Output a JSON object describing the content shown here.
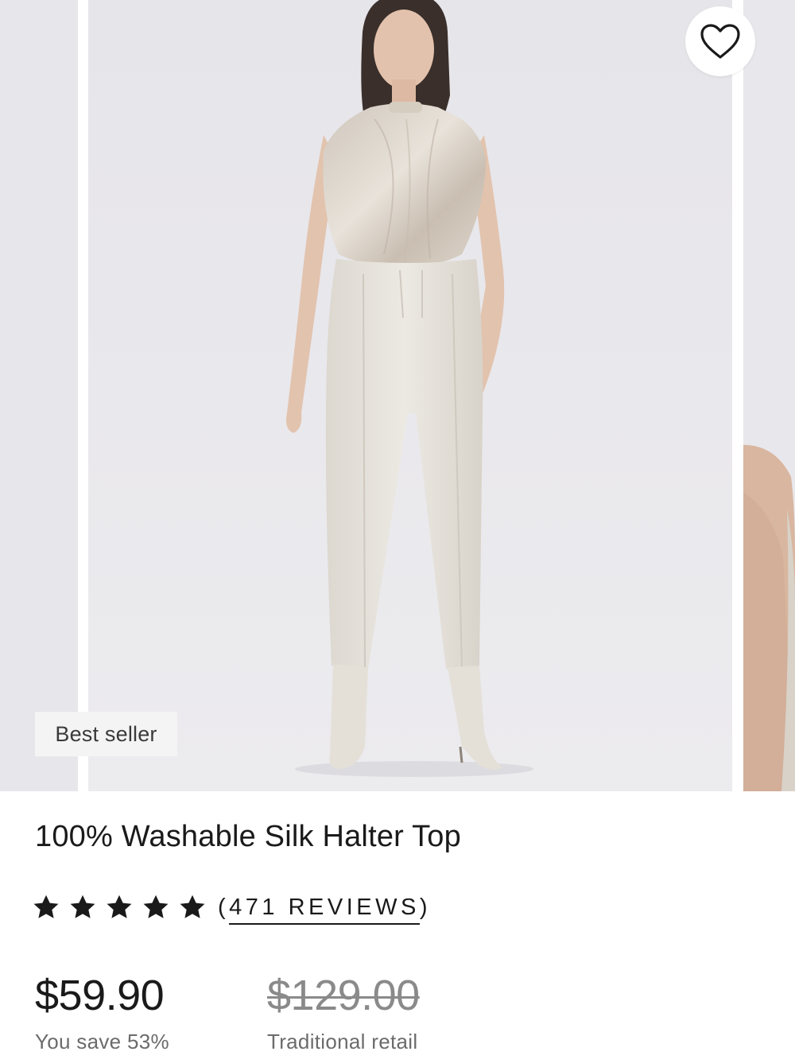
{
  "product": {
    "badge": "Best seller",
    "title": "100% Washable Silk Halter Top",
    "rating": {
      "stars": 5,
      "open": "(",
      "reviews_text": "471 REVIEWS",
      "close": ")"
    },
    "price": {
      "current": "$59.90",
      "savings": "You save 53%",
      "original": "$129.00",
      "original_label": "Traditional retail"
    }
  },
  "icons": {
    "favorite": "heart-outline-icon",
    "rating": "star-icon"
  },
  "colors": {
    "image_background": "#e9e8ec",
    "badge_background": "#f4f4f4",
    "text_primary": "#1a1a1a",
    "text_secondary": "#6b6b6b",
    "strikethrough_price": "#8a8a8a"
  }
}
